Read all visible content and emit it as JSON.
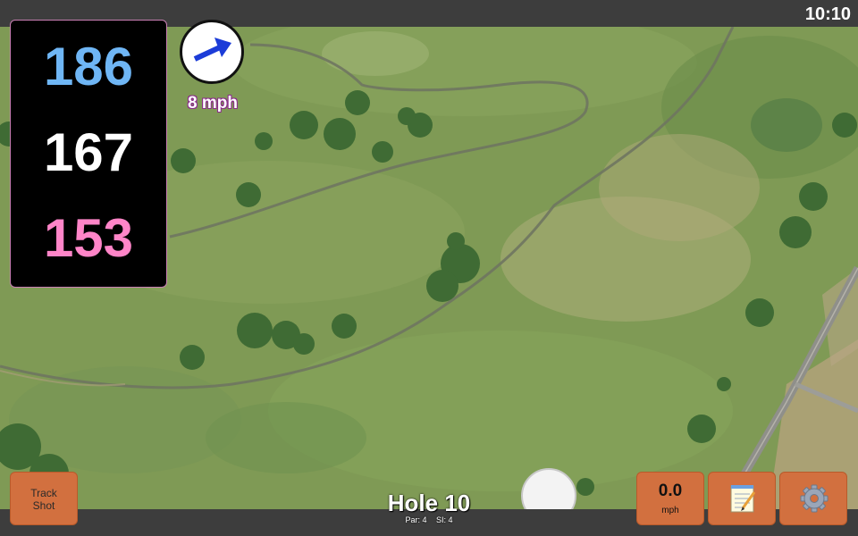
{
  "status_bar": {
    "clock": "10:10"
  },
  "distances": {
    "back": "186",
    "middle": "167",
    "front": "153",
    "colors": {
      "back": "#6fb6f5",
      "middle": "#ffffff",
      "front": "#ff85c8"
    }
  },
  "wind": {
    "speed_label": "8 mph",
    "direction_icon": "arrow-icon"
  },
  "buttons": {
    "track_shot_line1": "Track",
    "track_shot_line2": "Shot",
    "speed_value": "0.0",
    "speed_unit": "mph",
    "notes_icon": "notepad-icon",
    "settings_icon": "gear-icon"
  },
  "hole": {
    "title": "Hole 10",
    "par": "Par: 4",
    "stroke_index": "SI: 4"
  },
  "colors": {
    "button_orange": "#d2703f",
    "panel_border": "#c97fb4",
    "bar_gray": "#3d3d3d"
  }
}
